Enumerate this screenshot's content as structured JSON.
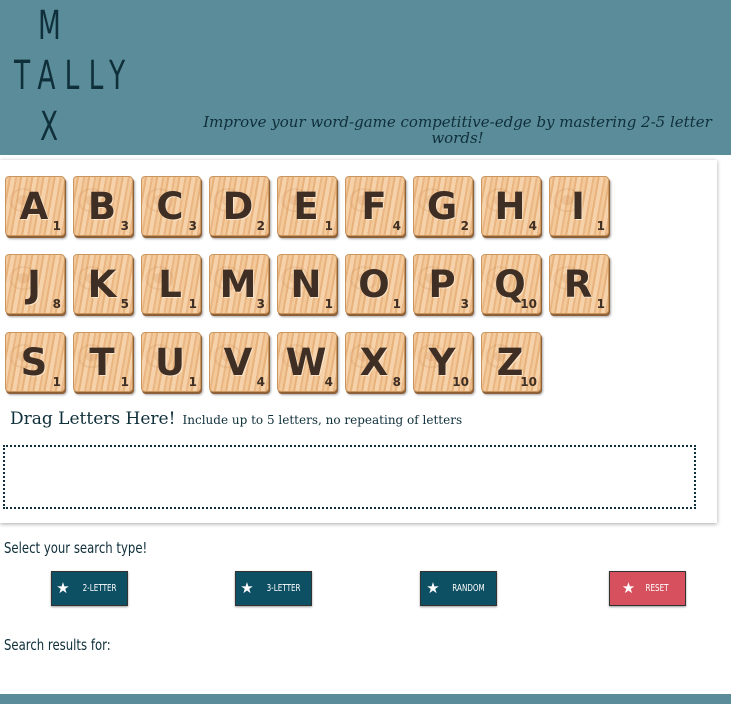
{
  "header": {
    "logo_lines": [
      "M",
      "TALLY",
      "X"
    ],
    "tagline": "Improve your word-game competitive-edge by mastering 2-5 letter words!",
    "background_color": "#5a8c99"
  },
  "tiles": [
    {
      "letter": "A",
      "points": "1"
    },
    {
      "letter": "B",
      "points": "3"
    },
    {
      "letter": "C",
      "points": "3"
    },
    {
      "letter": "D",
      "points": "2"
    },
    {
      "letter": "E",
      "points": "1"
    },
    {
      "letter": "F",
      "points": "4"
    },
    {
      "letter": "G",
      "points": "2"
    },
    {
      "letter": "H",
      "points": "4"
    },
    {
      "letter": "I",
      "points": "1"
    },
    {
      "letter": "J",
      "points": "8"
    },
    {
      "letter": "K",
      "points": "5"
    },
    {
      "letter": "L",
      "points": "1"
    },
    {
      "letter": "M",
      "points": "3"
    },
    {
      "letter": "N",
      "points": "1"
    },
    {
      "letter": "O",
      "points": "1"
    },
    {
      "letter": "P",
      "points": "3"
    },
    {
      "letter": "Q",
      "points": "10"
    },
    {
      "letter": "R",
      "points": "1"
    },
    {
      "letter": "S",
      "points": "1"
    },
    {
      "letter": "T",
      "points": "1"
    },
    {
      "letter": "U",
      "points": "1"
    },
    {
      "letter": "V",
      "points": "4"
    },
    {
      "letter": "W",
      "points": "4"
    },
    {
      "letter": "X",
      "points": "8"
    },
    {
      "letter": "Y",
      "points": "10"
    },
    {
      "letter": "Z",
      "points": "10"
    }
  ],
  "drag": {
    "title": "Drag Letters Here!",
    "hint": "Include up to 5 letters, no repeating of letters"
  },
  "search": {
    "label": "Select your search type!",
    "buttons": [
      {
        "label": "2-LETTER",
        "icon": "star-icon"
      },
      {
        "label": "3-LETTER",
        "icon": "star-icon"
      },
      {
        "label": "RANDOM",
        "icon": "star-icon"
      },
      {
        "label": "RESET",
        "icon": "star-icon"
      }
    ],
    "results_label": "Search results for:"
  },
  "colors": {
    "primary_button": "#0d4f63",
    "reset_button": "#d6505e",
    "text_dark": "#0f2f3a"
  }
}
